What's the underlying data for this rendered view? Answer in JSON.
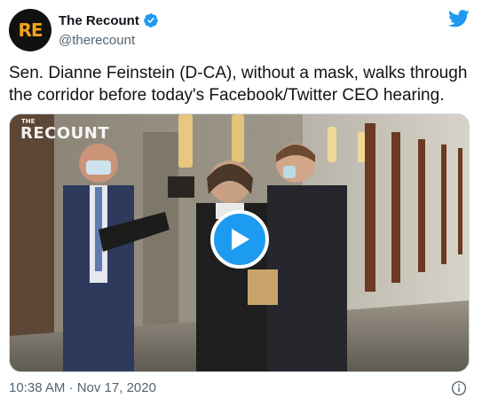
{
  "account": {
    "display_name": "The Recount",
    "handle": "@therecount",
    "avatar_text": "RE",
    "avatar_accent": "#f3a21b",
    "verified": true
  },
  "tweet": {
    "text": "Sen. Dianne Feinstein (D-CA), without a mask, walks through the corridor before today's Facebook/Twitter CEO hearing.",
    "timestamp": "10:38 AM · Nov 17, 2020"
  },
  "media": {
    "type": "video",
    "watermark": "RECOUNT",
    "watermark_small": "THE",
    "play_icon": "play-icon"
  },
  "colors": {
    "brand": "#1d9bf0",
    "text": "#0f1419",
    "secondary": "#536471"
  }
}
